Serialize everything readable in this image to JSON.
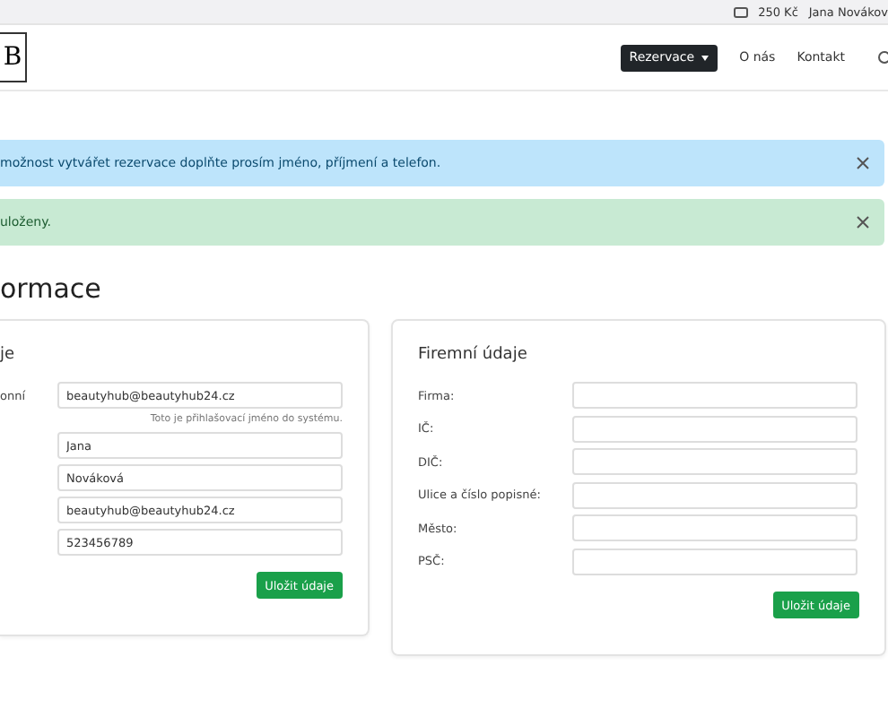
{
  "topbar": {
    "credit": "250 Kč",
    "user": "Jana Novákov"
  },
  "navbar": {
    "logo": "B",
    "menu_button": "Rezervace",
    "links": [
      "O nás",
      "Kontakt"
    ]
  },
  "alerts": [
    {
      "kind": "info",
      "text": "možnost vytvářet rezervace doplňte prosím jméno, příjmení a telefon."
    },
    {
      "kind": "success",
      "text": "uloženy."
    }
  ],
  "heading": "ormace",
  "personal": {
    "title": "je",
    "rows": [
      {
        "label": "onní",
        "value": "beautyhub@beautyhub24.cz",
        "help": "Toto je přihlašovací jméno do systému."
      },
      {
        "value": "Jana"
      },
      {
        "value": "Nováková"
      },
      {
        "value": "beautyhub@beautyhub24.cz"
      },
      {
        "value": "523456789"
      }
    ],
    "button": "Uložit údaje"
  },
  "company": {
    "title": "Firemní údaje",
    "rows": [
      {
        "label": "Firma:"
      },
      {
        "label": "IČ:"
      },
      {
        "label": "DIČ:"
      },
      {
        "label": "Ulice a číslo popisné:"
      },
      {
        "label": "Město:"
      },
      {
        "label": "PSČ:"
      }
    ],
    "button": "Uložit údaje"
  }
}
